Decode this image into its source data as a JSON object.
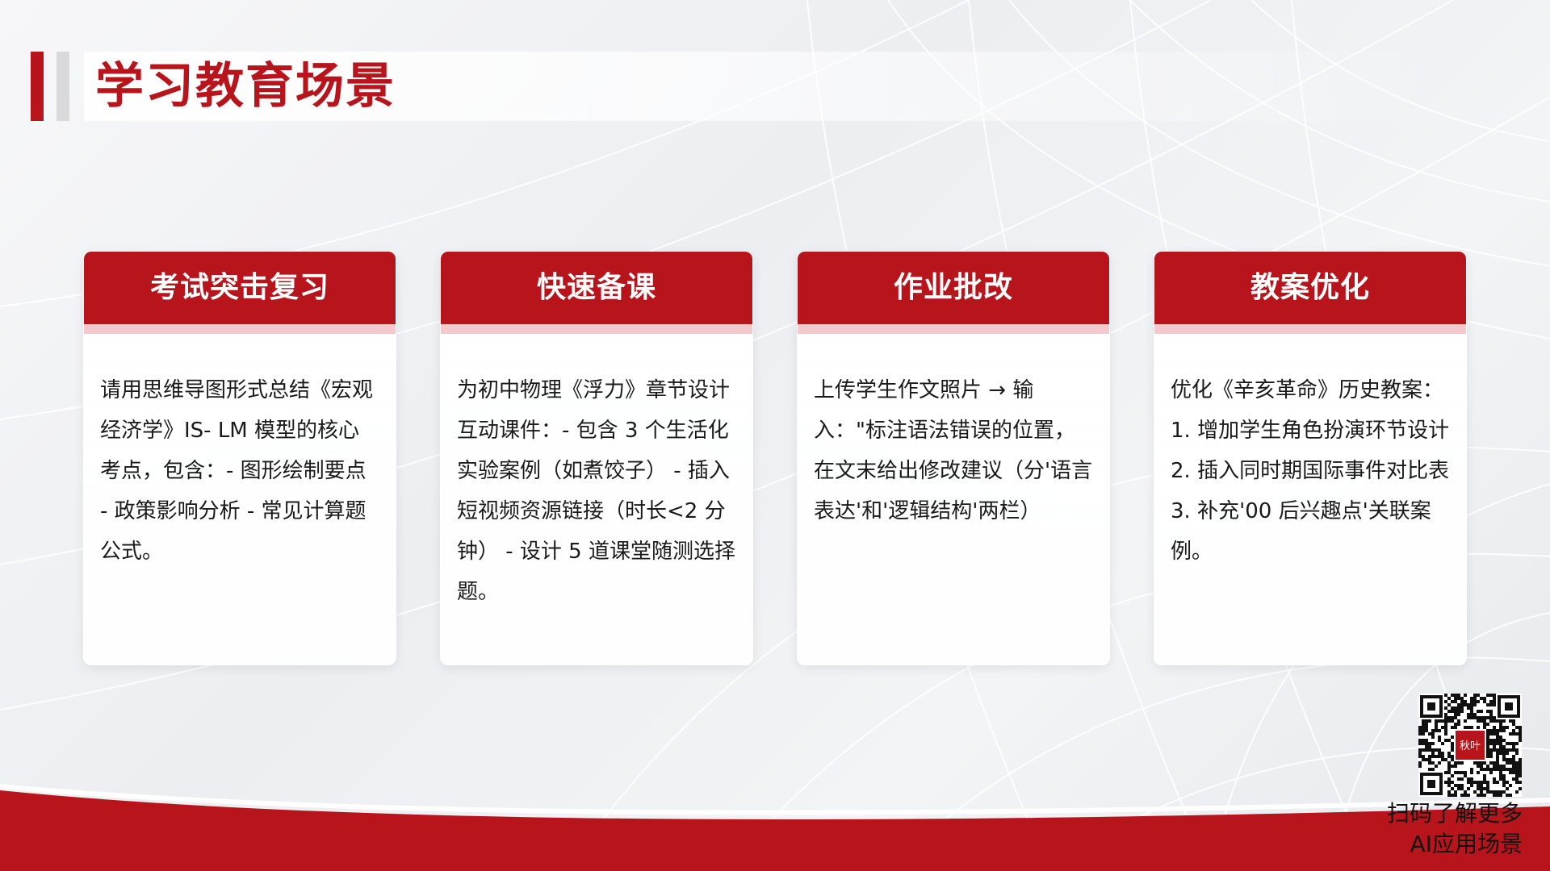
{
  "header": {
    "title": "学习教育场景"
  },
  "cards": [
    {
      "title": "考试突击复习",
      "body": "请用思维导图形式总结《宏观经济学》IS- LM 模型的核心考点，包含：- 图形绘制要点 - 政策影响分析 - 常见计算题公式。"
    },
    {
      "title": "快速备课",
      "body": "为初中物理《浮力》章节设计互动课件：- 包含 3 个生活化实验案例（如煮饺子） - 插入短视频资源链接（时长<2 分钟） - 设计 5 道课堂随测选择题。"
    },
    {
      "title": "作业批改",
      "body": "上传学生作文照片 → 输入：\"标注语法错误的位置，在文末给出修改建议（分'语言表达'和'逻辑结构'两栏）"
    },
    {
      "title": "教案优化",
      "body": "优化《辛亥革命》历史教案：1. 增加学生角色扮演环节设计 2. 插入同时期国际事件对比表 3. 补充'00 后兴趣点'关联案例。"
    }
  ],
  "qr": {
    "center_label": "秋叶",
    "caption_line1": "扫码了解更多",
    "caption_line2": "AI应用场景"
  },
  "colors": {
    "primary_red": "#b8141c",
    "accent_pink": "#f3c9cd",
    "background": "#eceef2"
  }
}
